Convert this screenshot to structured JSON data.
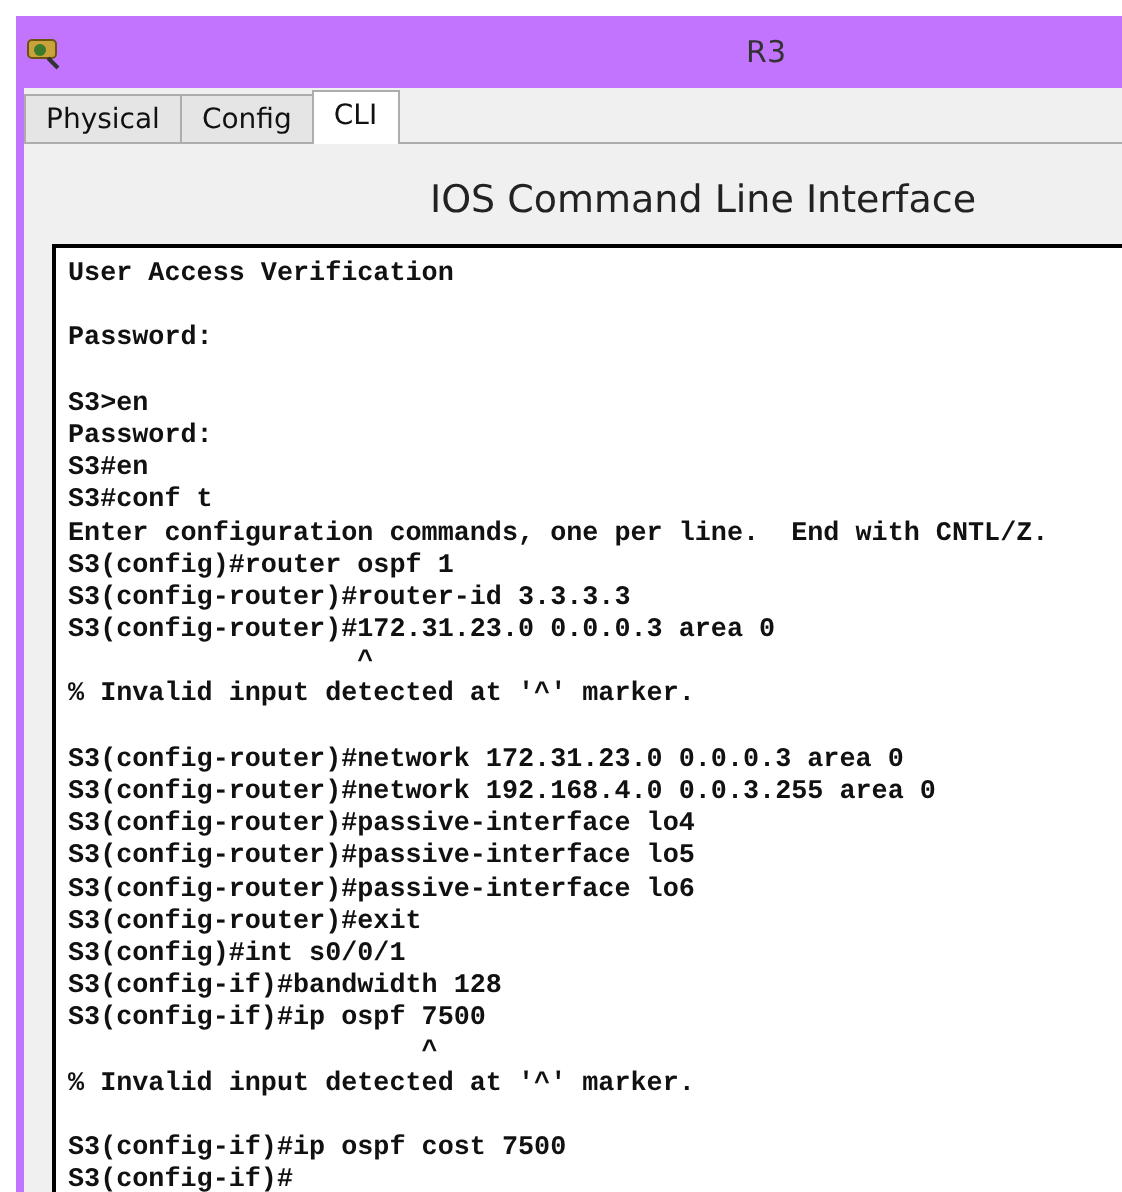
{
  "window": {
    "title": "R3"
  },
  "tabs": [
    {
      "label": "Physical",
      "selected": false
    },
    {
      "label": "Config",
      "selected": false
    },
    {
      "label": "CLI",
      "selected": true
    }
  ],
  "heading": "IOS Command Line Interface",
  "terminal": {
    "lines": [
      {
        "kind": "text",
        "text": "User Access Verification"
      },
      {
        "kind": "blank"
      },
      {
        "kind": "text",
        "text": "Password:"
      },
      {
        "kind": "blank"
      },
      {
        "kind": "text",
        "text": "S3>en"
      },
      {
        "kind": "text",
        "text": "Password:"
      },
      {
        "kind": "text",
        "text": "S3#en"
      },
      {
        "kind": "text",
        "text": "S3#conf t"
      },
      {
        "kind": "text",
        "text": "Enter configuration commands, one per line.  End with CNTL/Z."
      },
      {
        "kind": "text",
        "text": "S3(config)#router ospf 1"
      },
      {
        "kind": "text",
        "text": "S3(config-router)#router-id 3.3.3.3"
      },
      {
        "kind": "text",
        "text": "S3(config-router)#172.31.23.0 0.0.0.3 area 0"
      },
      {
        "kind": "text",
        "text": "                  ^"
      },
      {
        "kind": "text",
        "text": "% Invalid input detected at '^' marker."
      },
      {
        "kind": "blank"
      },
      {
        "kind": "text",
        "text": "S3(config-router)#network 172.31.23.0 0.0.0.3 area 0"
      },
      {
        "kind": "text",
        "text": "S3(config-router)#network 192.168.4.0 0.0.3.255 area 0"
      },
      {
        "kind": "text",
        "text": "S3(config-router)#passive-interface lo4"
      },
      {
        "kind": "text",
        "text": "S3(config-router)#passive-interface lo5"
      },
      {
        "kind": "text",
        "text": "S3(config-router)#passive-interface lo6"
      },
      {
        "kind": "text",
        "text": "S3(config-router)#exit"
      },
      {
        "kind": "text",
        "text": "S3(config)#int s0/0/1"
      },
      {
        "kind": "text",
        "text": "S3(config-if)#bandwidth 128"
      },
      {
        "kind": "text",
        "text": "S3(config-if)#ip ospf 7500"
      },
      {
        "kind": "text",
        "text": "                      ^"
      },
      {
        "kind": "text",
        "text": "% Invalid input detected at '^' marker."
      },
      {
        "kind": "blank"
      },
      {
        "kind": "text",
        "text": "S3(config-if)#ip ospf cost 7500"
      },
      {
        "kind": "text",
        "text": "S3(config-if)#"
      }
    ]
  }
}
